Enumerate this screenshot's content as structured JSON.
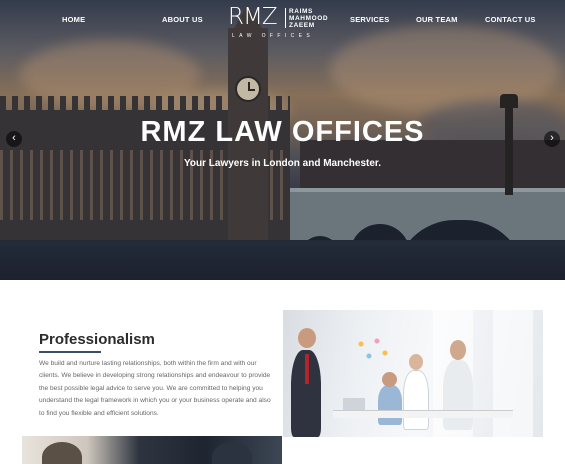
{
  "nav": {
    "home": "HOME",
    "about": "ABOUT US",
    "services": "SERVICES",
    "team": "OUR TEAM",
    "contact": "CONTACT US"
  },
  "logo": {
    "mark": "RMZ",
    "line1": "RAIMS",
    "line2": "MAHMOOD",
    "line3": "ZAEEM",
    "sub": "LAW OFFICES"
  },
  "hero": {
    "title": "RMZ LAW OFFICES",
    "subtitle": "Your Lawyers in London and Manchester.",
    "prev_arrow": "‹",
    "next_arrow": "›"
  },
  "professionalism": {
    "title": "Professionalism",
    "body": "We build and nurture lasting relationships, both within the firm and with our clients. We believe in developing strong relationships and endeavour to provide the best possible legal advice to serve you. We are committed to helping you understand the legal framework in which you or your business operate and also to find you flexible and efficient solutions."
  },
  "colors": {
    "accent": "#3a4e6b",
    "text": "#666666",
    "heading": "#2c2c2c"
  }
}
